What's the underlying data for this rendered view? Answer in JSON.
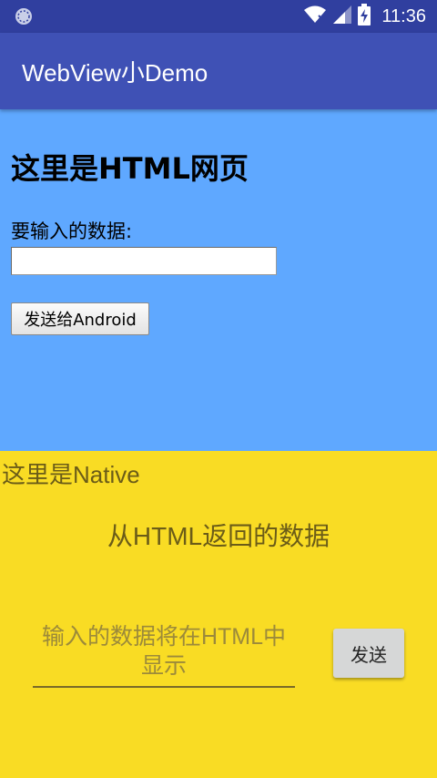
{
  "status_bar": {
    "time": "11:36",
    "icons": [
      "app-notification-icon",
      "wifi-icon",
      "cell-signal-icon",
      "battery-charging-icon"
    ]
  },
  "app_bar": {
    "title": "WebView小Demo"
  },
  "webview": {
    "heading": "这里是HTML网页",
    "input_label": "要输入的数据:",
    "input_value": "",
    "send_button": "发送给Android",
    "background": "#5FA8FF"
  },
  "native": {
    "label": "这里是Native",
    "result_text": "从HTML返回的数据",
    "input_placeholder": "输入的数据将在HTML中显示",
    "send_button": "发送",
    "background": "#F9DC24"
  },
  "colors": {
    "primary": "#3F51B5",
    "primary_dark": "#303F9F"
  }
}
